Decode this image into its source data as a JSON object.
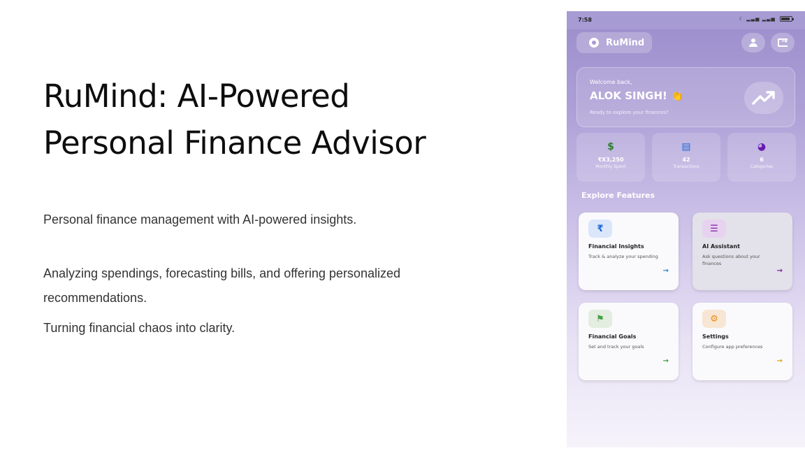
{
  "slide": {
    "title_line1": "RuMind: AI-Powered",
    "title_line2": "Personal Finance Advisor",
    "paragraph1": "Personal finance management with AI-powered insights.",
    "paragraph2": "Analyzing spendings, forecasting bills, and offering personalized recommendations.",
    "paragraph3": "Turning financial chaos into clarity."
  },
  "phone": {
    "status": {
      "time": "7:58",
      "battery": "92"
    },
    "brand": "RuMind",
    "welcome": {
      "greeting": "Welcome back,",
      "name": "ALOK SINGH!",
      "emoji": "👏",
      "subtitle": "Ready to explore your finances?"
    },
    "stats": [
      {
        "icon": "dollar-icon",
        "glyph": "$",
        "value": "₹X3,250",
        "label": "Monthly Spent",
        "color": "#2e7d32"
      },
      {
        "icon": "receipt-icon",
        "glyph": "▤",
        "value": "42",
        "label": "Transactions",
        "color": "#1e66d6"
      },
      {
        "icon": "pie-chart-icon",
        "glyph": "◕",
        "value": "6",
        "label": "Categories",
        "color": "#6a1bb0"
      }
    ],
    "section_title": "Explore Features",
    "features": [
      {
        "icon": "rupee-icon",
        "glyph": "₹",
        "title": "Financial Insights",
        "description": "Track & analyze your spending",
        "icon_bg": "#dbe6fb",
        "icon_color": "#1e66d6",
        "arrow_color": "#2c86c9"
      },
      {
        "icon": "chat-icon",
        "glyph": "☰",
        "title": "AI Assistant",
        "description": "Ask questions about your finances",
        "icon_bg": "#e7d2f0",
        "icon_color": "#7b1fa2",
        "arrow_color": "#7b1fa2"
      },
      {
        "icon": "flag-icon",
        "glyph": "⚑",
        "title": "Financial Goals",
        "description": "Set and track your goals",
        "icon_bg": "#e3ede0",
        "icon_color": "#43a047",
        "arrow_color": "#43a047"
      },
      {
        "icon": "gear-icon",
        "glyph": "⚙",
        "title": "Settings",
        "description": "Configure app preferences",
        "icon_bg": "#f7e6d3",
        "icon_color": "#ef8c1a",
        "arrow_color": "#e6a015"
      }
    ],
    "arrow_glyph": "→"
  }
}
